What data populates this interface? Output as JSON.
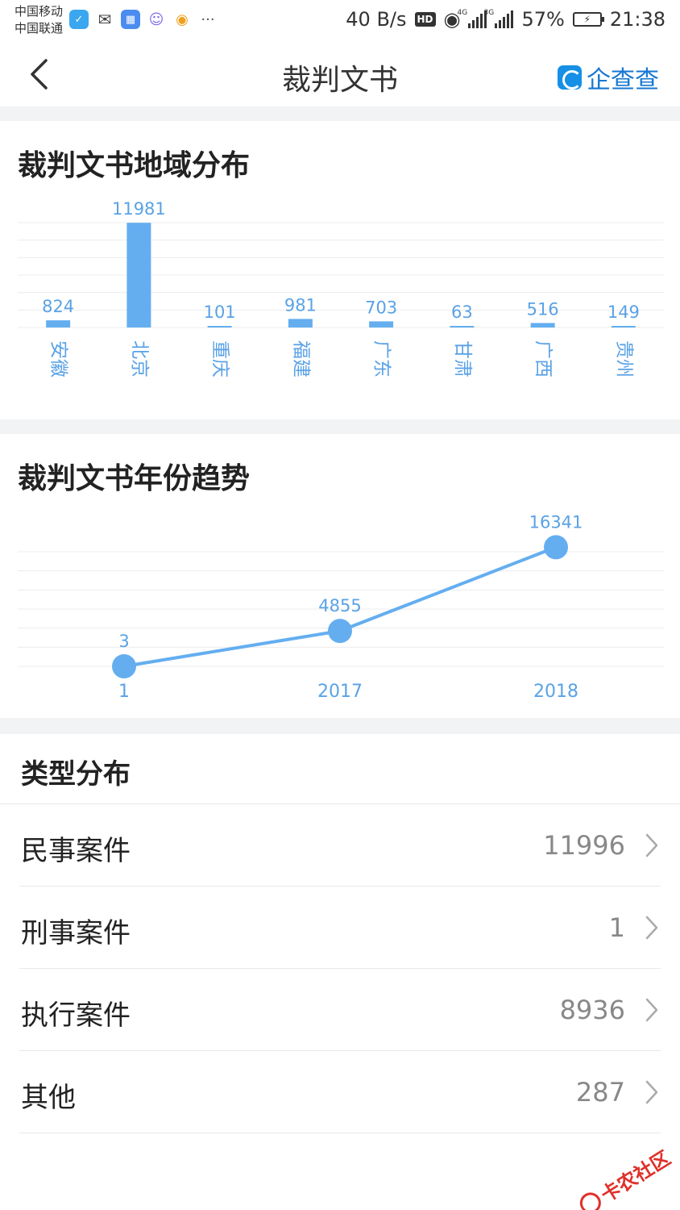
{
  "status_bar": {
    "carrier_1": "中国移动",
    "carrier_2": "中国联通",
    "net_speed": "40 B/s",
    "hd": "HD",
    "signal_1_tag": "4G",
    "signal_2_tag": "3G",
    "battery": "57%",
    "time": "21:38",
    "more": "···"
  },
  "navbar": {
    "title": "裁判文书",
    "brand": "企查查"
  },
  "region_card": {
    "title": "裁判文书地域分布"
  },
  "year_card": {
    "title": "裁判文书年份趋势"
  },
  "chart_data": [
    {
      "type": "bar",
      "title": "裁判文书地域分布",
      "categories": [
        "安徽",
        "北京",
        "重庆",
        "福建",
        "广东",
        "甘肃",
        "广西",
        "贵州"
      ],
      "values": [
        824,
        11981,
        101,
        981,
        703,
        63,
        516,
        149
      ],
      "ylim": [
        0,
        12000
      ],
      "grid": true,
      "color": "#64aef0"
    },
    {
      "type": "line",
      "title": "裁判文书年份趋势",
      "categories": [
        "1",
        "2017",
        "2018"
      ],
      "values": [
        3,
        4855,
        16341
      ],
      "grid": true,
      "color": "#64aef0"
    }
  ],
  "types": {
    "title": "类型分布",
    "items": [
      {
        "label": "民事案件",
        "count": "11996"
      },
      {
        "label": "刑事案件",
        "count": "1"
      },
      {
        "label": "执行案件",
        "count": "8936"
      },
      {
        "label": "其他",
        "count": "287"
      }
    ]
  },
  "watermark": "卡农社区",
  "colors": {
    "accent": "#64aef0",
    "brand": "#1677d2",
    "background": "#f2f3f5"
  }
}
